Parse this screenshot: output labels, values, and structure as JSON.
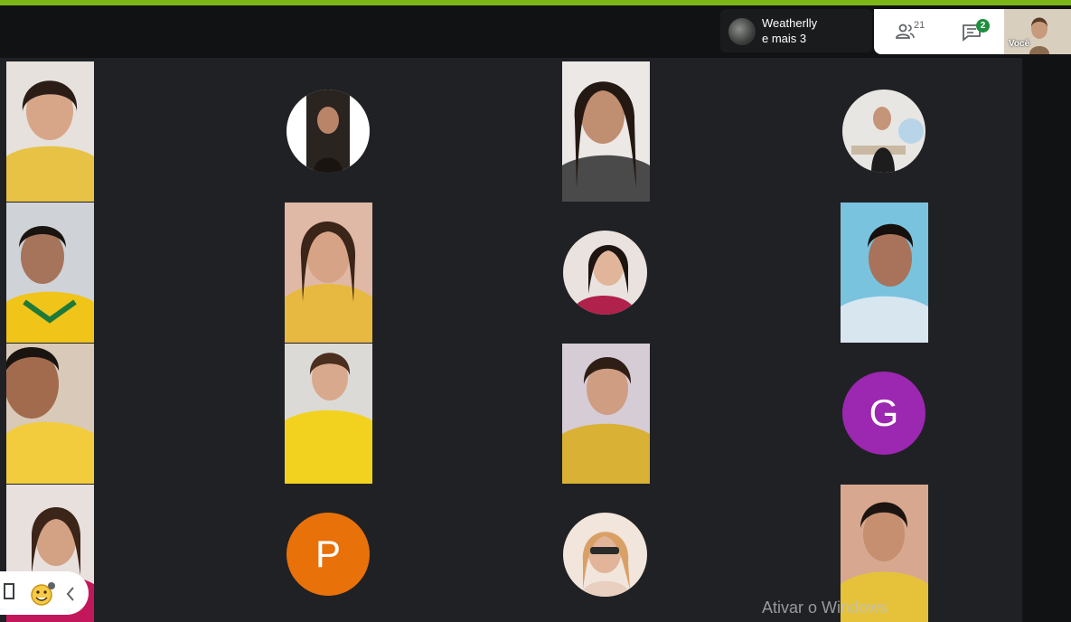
{
  "theme": {
    "stripe": "#7cb518",
    "panel": "#ffffff",
    "chat_badge": "#1e8e3e",
    "tile_letter_g": "#9c27b0",
    "tile_letter_p": "#e8710a"
  },
  "presenter": {
    "name": "Weatherlly",
    "others": "e mais 3"
  },
  "toolbar": {
    "people_count": "21",
    "chat_unread": "2",
    "people_icon": "people-icon",
    "chat_icon": "chat-icon"
  },
  "self_view": {
    "label": "Você"
  },
  "participants": {
    "g_letter": "G",
    "p_letter": "P"
  },
  "bottom_toolbar": {
    "icons": [
      "doc-icon",
      "emoji-icon",
      "chevron-left-icon"
    ]
  },
  "watermark": {
    "text": "Ativar o Windows"
  }
}
